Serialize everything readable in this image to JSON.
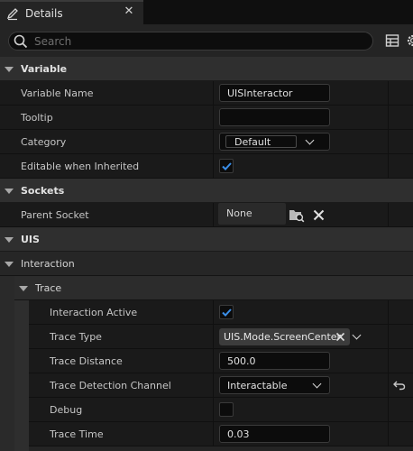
{
  "tab": {
    "title": "Details",
    "icon": "pencil-icon",
    "close": "✕"
  },
  "search": {
    "placeholder": "Search"
  },
  "categories": {
    "variable": "Variable",
    "sockets": "Sockets",
    "uis": "UIS",
    "interaction": "Interaction",
    "trace": "Trace"
  },
  "variable": {
    "name_label": "Variable Name",
    "name_value": "UISInteractor",
    "tooltip_label": "Tooltip",
    "tooltip_value": "",
    "category_label": "Category",
    "category_value": "Default",
    "editable_label": "Editable when Inherited",
    "editable_checked": true
  },
  "sockets": {
    "parent_label": "Parent Socket",
    "parent_value": "None"
  },
  "trace": {
    "active_label": "Interaction Active",
    "active_checked": true,
    "type_label": "Trace Type",
    "type_value": "UIS.Mode.ScreenCenter",
    "distance_label": "Trace Distance",
    "distance_value": "500.0",
    "channel_label": "Trace Detection Channel",
    "channel_value": "Interactable",
    "debug_label": "Debug",
    "debug_checked": false,
    "time_label": "Trace Time",
    "time_value": "0.03"
  },
  "colors": {
    "accent": "#2f7fe0",
    "check": "#3a8ee8"
  }
}
